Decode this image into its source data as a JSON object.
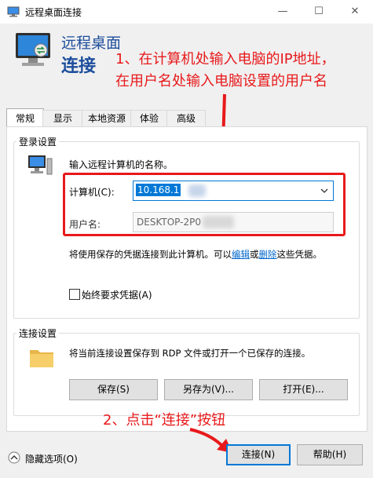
{
  "window": {
    "title": "远程桌面连接",
    "minimize_glyph": "—",
    "maximize_glyph": "☐",
    "close_glyph": "✕"
  },
  "header": {
    "title_line1": "远程桌面",
    "title_line2": "连接",
    "annotation_line1": "1、在计算机处输入电脑的IP地址，",
    "annotation_line2": "在用户名处输入电脑设置的用户名"
  },
  "tabs": [
    {
      "label": "常规"
    },
    {
      "label": "显示"
    },
    {
      "label": "本地资源"
    },
    {
      "label": "体验"
    },
    {
      "label": "高级"
    }
  ],
  "login": {
    "group_title": "登录设置",
    "prompt": "输入远程计算机的名称。",
    "computer_label": "计算机(C):",
    "computer_value": "10.168.1",
    "username_label": "用户名:",
    "username_value": "DESKTOP-2P0",
    "saved_note_prefix": "将使用保存的凭据连接到此计算机。可以",
    "edit_link": "编辑",
    "or_text": "或",
    "delete_link": "删除",
    "saved_note_suffix": "这些凭据。",
    "always_ask_label": "始终要求凭据(A)"
  },
  "connection": {
    "group_title": "连接设置",
    "description": "将当前连接设置保存到 RDP 文件或打开一个已保存的连接。",
    "save_label": "保存(S)",
    "save_as_label": "另存为(V)...",
    "open_label": "打开(E)..."
  },
  "annotation2": "2、点击“连接”按钮",
  "footer": {
    "hide_options_label": "隐藏选项(O)",
    "connect_label": "连接(N)",
    "help_label": "帮助(H)"
  },
  "colors": {
    "annotation": "#e8191b",
    "header_title": "#1d4e9c",
    "link": "#0066cc",
    "primary_border": "#0078d7"
  }
}
